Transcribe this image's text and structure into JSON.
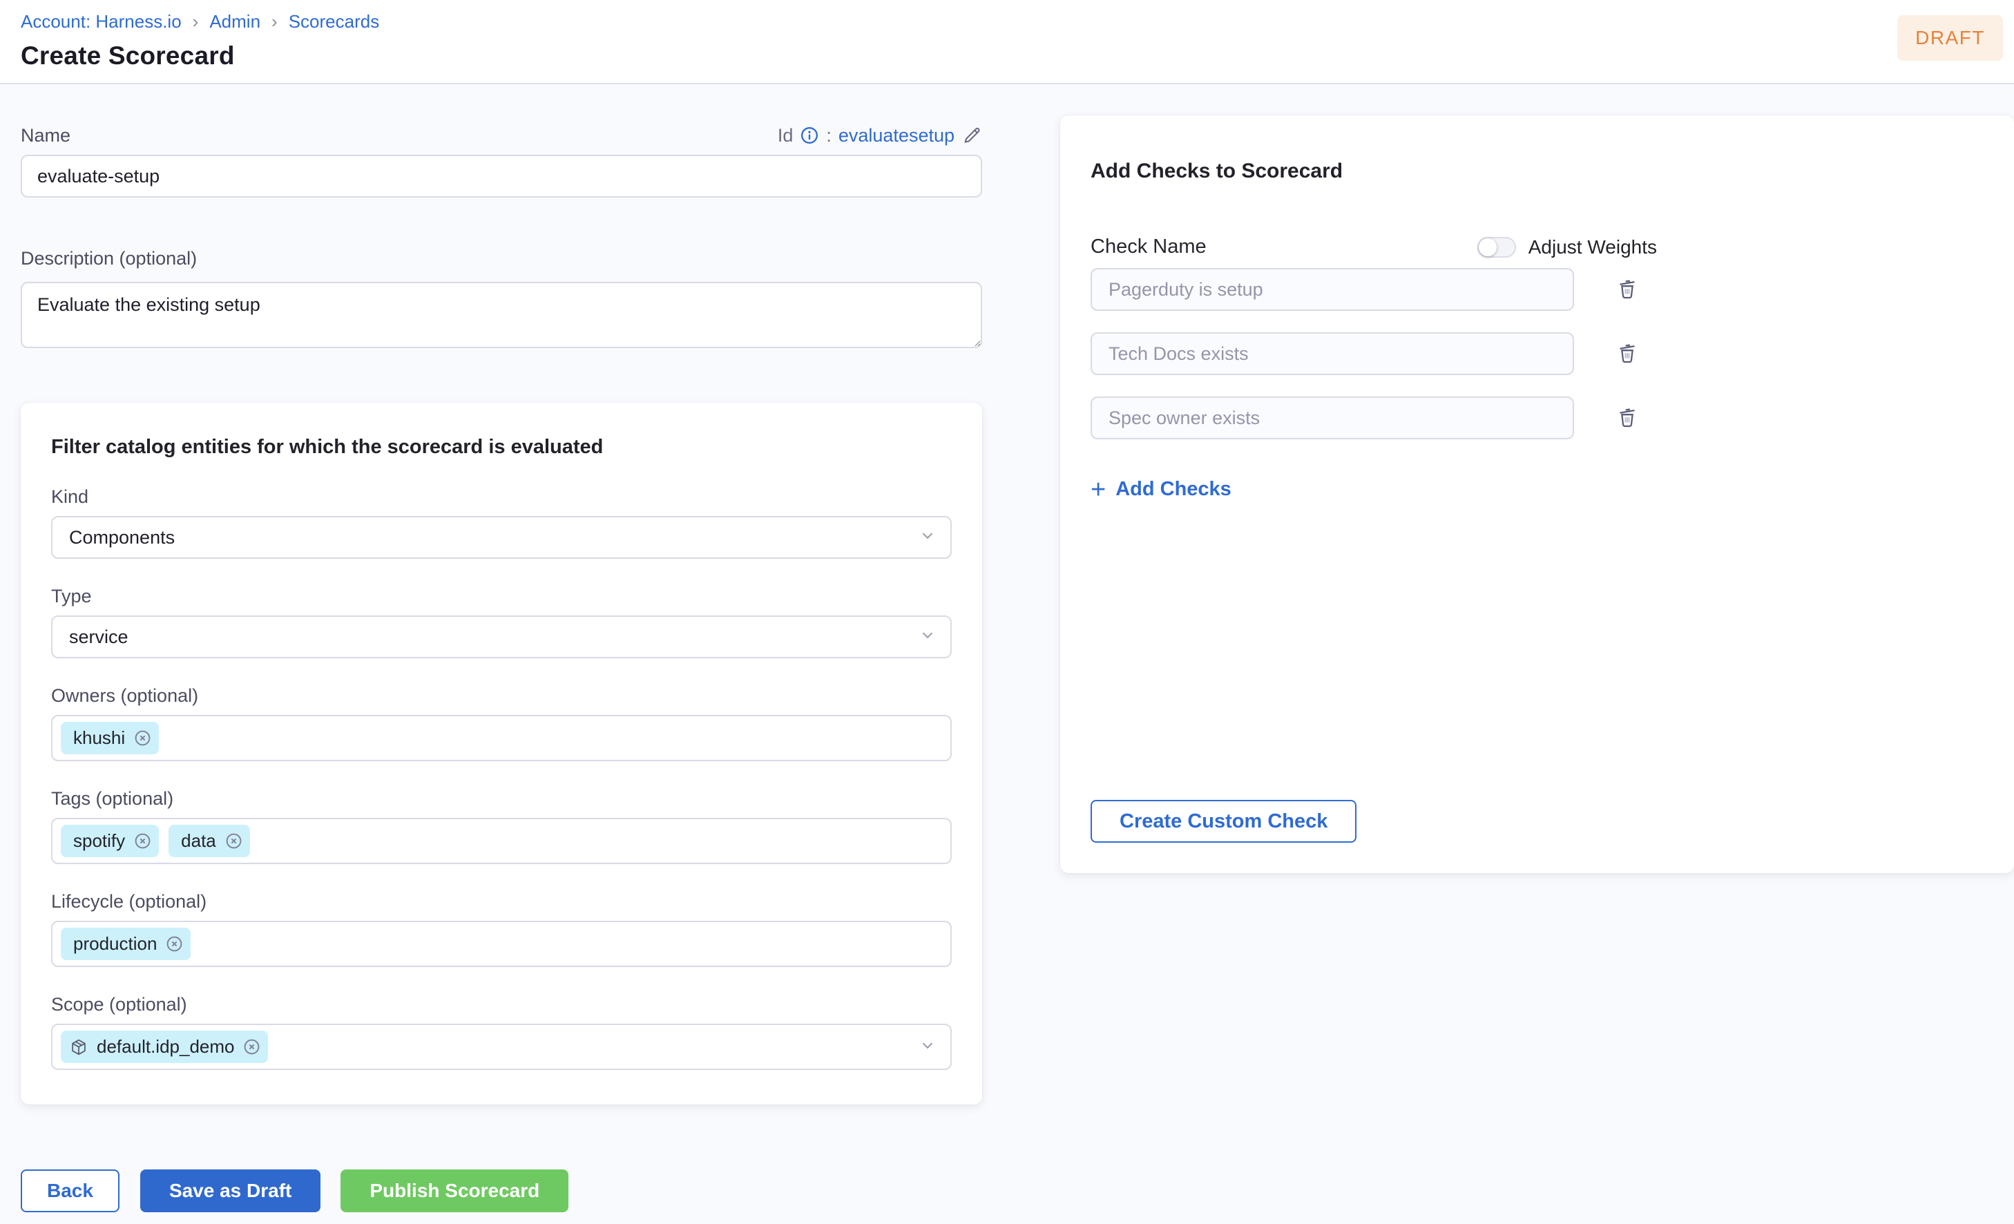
{
  "page": {
    "breadcrumb": {
      "items": [
        "Account: Harness.io",
        "Admin",
        "Scorecards"
      ],
      "separator": "›"
    },
    "title": "Create Scorecard",
    "status_badge": "DRAFT"
  },
  "form": {
    "name": {
      "label": "Name",
      "value": "evaluate-setup"
    },
    "id_row": {
      "label": "Id",
      "colon": ":",
      "value": "evaluatesetup"
    },
    "description": {
      "label": "Description (optional)",
      "value": "Evaluate the existing setup"
    },
    "filter": {
      "heading": "Filter catalog entities for which the scorecard is evaluated",
      "kind": {
        "label": "Kind",
        "value": "Components"
      },
      "type": {
        "label": "Type",
        "value": "service"
      },
      "owners": {
        "label": "Owners (optional)",
        "chips": [
          "khushi"
        ]
      },
      "tags": {
        "label": "Tags (optional)",
        "chips": [
          "spotify",
          "data"
        ]
      },
      "lifecycle": {
        "label": "Lifecycle (optional)",
        "chips": [
          "production"
        ]
      },
      "scope": {
        "label": "Scope (optional)",
        "chips": [
          "default.idp_demo"
        ]
      }
    },
    "actions": {
      "back": "Back",
      "save_draft": "Save as Draft",
      "publish": "Publish Scorecard"
    }
  },
  "checks_panel": {
    "heading": "Add Checks to Scorecard",
    "column_label": "Check Name",
    "adjust_weights_label": "Adjust Weights",
    "checks": [
      "Pagerduty is setup",
      "Tech Docs exists",
      "Spec owner exists"
    ],
    "add_checks_icon": "+",
    "add_checks_label": "Add Checks",
    "create_custom_check_label": "Create Custom Check"
  },
  "colors": {
    "link_blue": "#2F6BD2",
    "primary_blue": "#3069CE",
    "success_green": "#6FC962",
    "draft_text": "#E6813C",
    "draft_bg": "#FCF0E4",
    "chip_bg": "#CDF1FB",
    "input_border": "#D9DAE5",
    "page_bg": "#F9FAFD"
  }
}
